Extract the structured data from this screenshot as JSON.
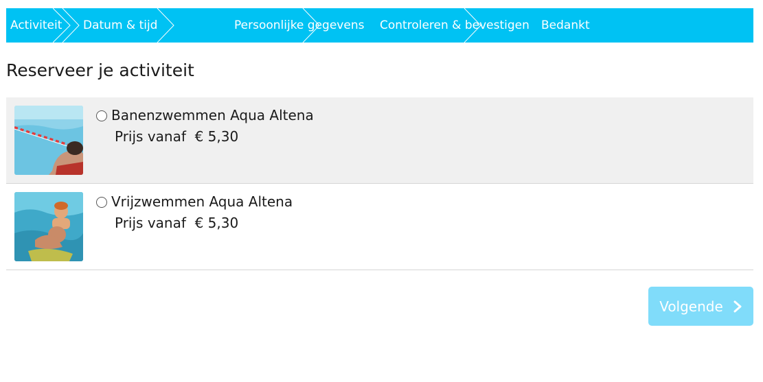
{
  "steps": [
    {
      "label": "Activiteit"
    },
    {
      "label": "Datum & tijd"
    },
    {
      "label": "Persoonlijke gegevens"
    },
    {
      "label": "Controleren & bevestigen"
    },
    {
      "label": "Bedankt"
    }
  ],
  "page": {
    "title": "Reserveer je activiteit"
  },
  "activities": [
    {
      "name": "Banenzwemmen Aqua Altena",
      "price": "Prijs vanaf  € 5,30",
      "image": "lane-swimming-photo"
    },
    {
      "name": "Vrijzwemmen Aqua Altena",
      "price": "Prijs vanaf  € 5,30",
      "image": "family-swimming-photo"
    }
  ],
  "actions": {
    "next_label": "Volgende"
  },
  "colors": {
    "steps_bar": "#00c2f3",
    "next_button": "#80dcfa",
    "selected_row": "#f0f0f0"
  }
}
